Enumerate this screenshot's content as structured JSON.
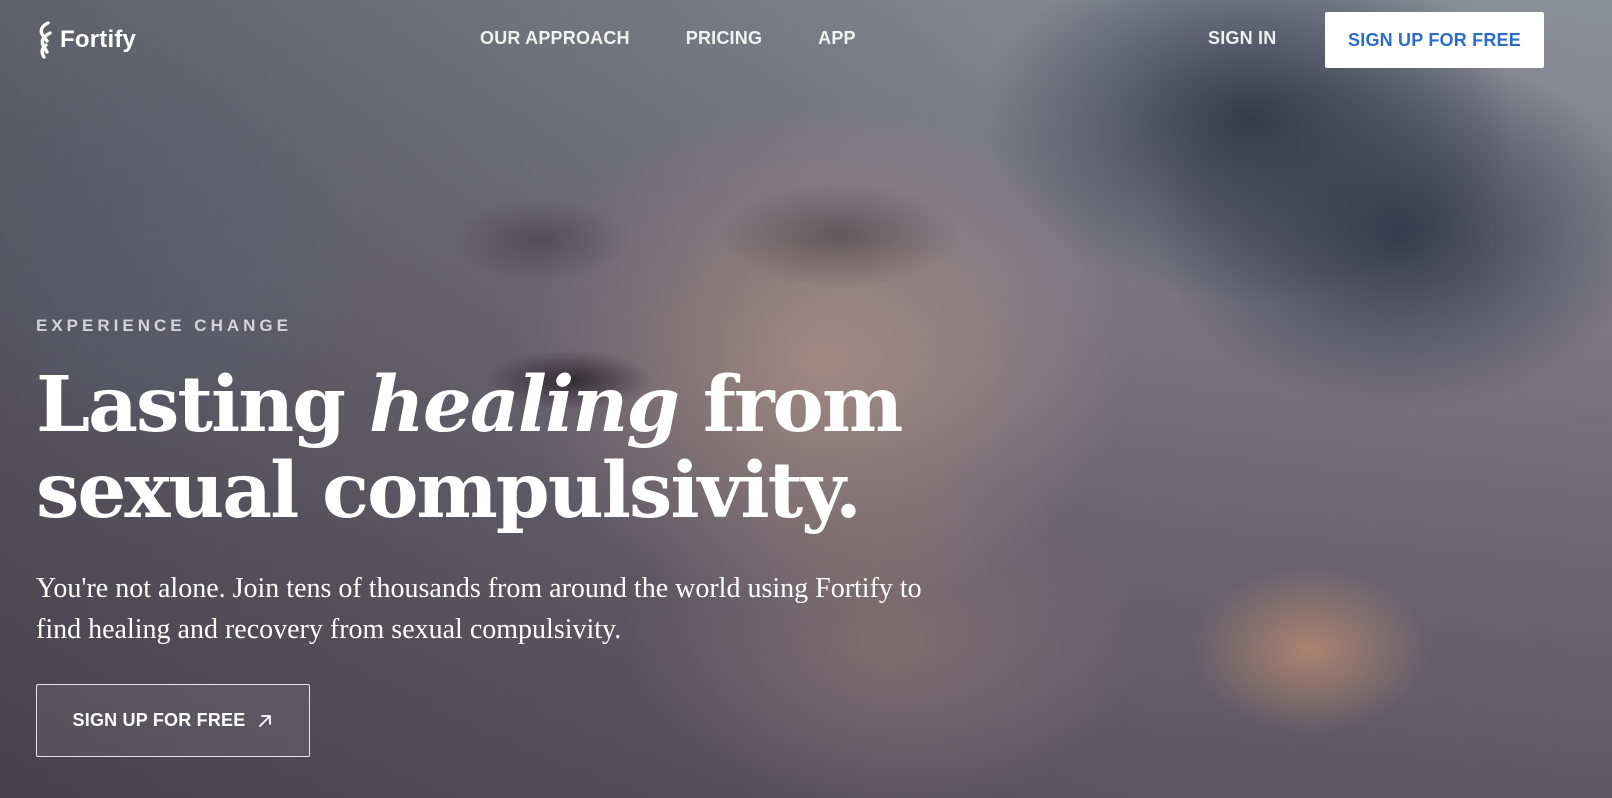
{
  "brand": {
    "name": "Fortify"
  },
  "nav": {
    "links": [
      {
        "label": "OUR APPROACH"
      },
      {
        "label": "PRICING"
      },
      {
        "label": "APP"
      }
    ],
    "sign_in": "SIGN IN",
    "signup_label": "SIGN UP FOR FREE"
  },
  "hero": {
    "eyebrow": "EXPERIENCE CHANGE",
    "headline_before": "Lasting ",
    "headline_emphasis": "healing",
    "headline_after": " from sexual compulsivity.",
    "subtext": "You're not alone. Join tens of thousands from around the world using Fortify to find healing and recovery from sexual compulsivity.",
    "cta_label": "SIGN UP FOR FREE"
  },
  "icons": {
    "logo": "fortify-logo-icon",
    "cta_arrow": "arrow-up-right-icon"
  },
  "colors": {
    "accent_blue": "#2b6dcc",
    "white": "#ffffff"
  }
}
